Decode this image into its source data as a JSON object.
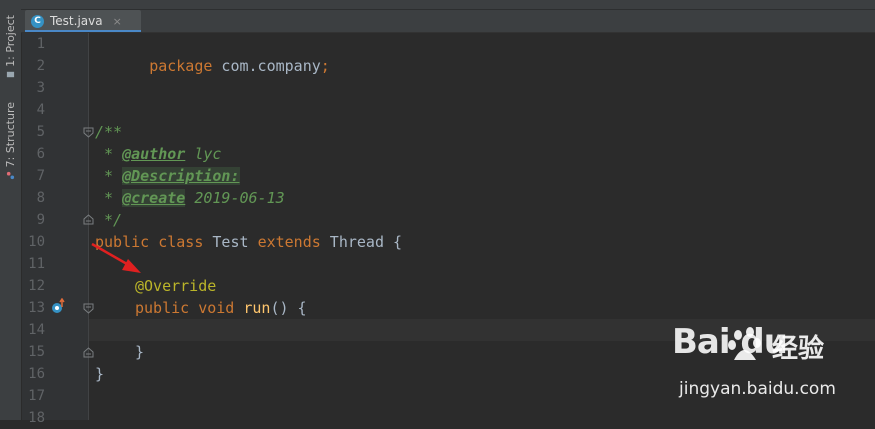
{
  "left_strip": {
    "project_tab": "1: Project",
    "structure_tab": "7: Structure"
  },
  "editor_tab": {
    "icon_letter": "C",
    "filename": "Test.java",
    "close": "×"
  },
  "line_numbers": [
    "1",
    "2",
    "3",
    "4",
    "5",
    "6",
    "7",
    "8",
    "9",
    "10",
    "11",
    "12",
    "13",
    "14",
    "15",
    "16",
    "17",
    "18"
  ],
  "code": {
    "l1_kw": "package",
    "l1_rest": " com.company",
    "l1_semi": ";",
    "l5": "/**",
    "l6_star": " * ",
    "l6_tag": "@author",
    "l6_val": " lyc",
    "l7_star": " * ",
    "l7_tag": "@Description:",
    "l8_star": " * ",
    "l8_tag": "@create",
    "l8_val": " 2019-06-13",
    "l9": " */",
    "l10_kw1": "public class",
    "l10_name": " Test ",
    "l10_kw2": "extends",
    "l10_rest": " Thread {",
    "l12_ann": "@Override",
    "l13_kw": "public void",
    "l13_method": "run",
    "l13_rest": "() {",
    "l15": "}",
    "l16": "}"
  },
  "watermark": {
    "logo": "Bai  du",
    "jingyan": "经验",
    "url": "jingyan.baidu.com"
  },
  "colors": {
    "background": "#2b2b2b",
    "keyword": "#cc7832",
    "annotation": "#bbb529",
    "doc_comment": "#629755",
    "method": "#ffc66d",
    "plain": "#a9b7c6",
    "arrow": "#e02020"
  }
}
